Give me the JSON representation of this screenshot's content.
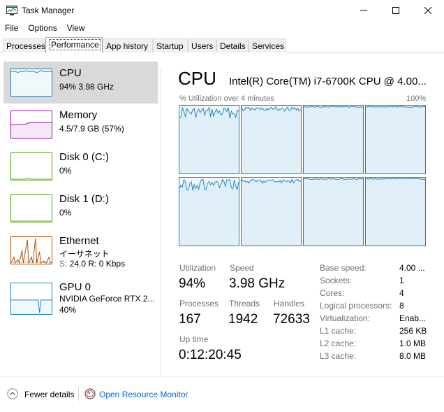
{
  "window": {
    "title": "Task Manager",
    "icon": "task-manager-icon"
  },
  "menu": [
    "File",
    "Options",
    "View"
  ],
  "tabs": [
    "Processes",
    "Performance",
    "App history",
    "Startup",
    "Users",
    "Details",
    "Services"
  ],
  "active_tab": "Performance",
  "sidebar": {
    "cpu": {
      "title": "CPU",
      "sub": "94%  3.98 GHz"
    },
    "memory": {
      "title": "Memory",
      "sub": "4.5/7.9 GB (57%)"
    },
    "disk0": {
      "title": "Disk 0 (C:)",
      "sub": "0%"
    },
    "disk1": {
      "title": "Disk 1 (D:)",
      "sub": "0%"
    },
    "ethernet": {
      "title": "Ethernet",
      "sub1": "イーサネット",
      "sub2_label": "S:",
      "sub2": "24.0  R: 0 Kbps"
    },
    "gpu": {
      "title": "GPU 0",
      "sub1": "NVIDIA GeForce RTX 2...",
      "sub2": "40%"
    }
  },
  "main": {
    "title": "CPU",
    "model": "Intel(R) Core(TM) i7-6700K CPU @ 4.00...",
    "graph_label_left": "% Utilization over 4 minutes",
    "graph_label_right": "100%",
    "stats": {
      "utilization_label": "Utilization",
      "utilization": "94%",
      "speed_label": "Speed",
      "speed": "3.98 GHz",
      "processes_label": "Processes",
      "processes": "167",
      "threads_label": "Threads",
      "threads": "1942",
      "handles_label": "Handles",
      "handles": "72633",
      "uptime_label": "Up time",
      "uptime": "0:12:20:45"
    },
    "specs": [
      {
        "label": "Base speed:",
        "value": "4.00 ..."
      },
      {
        "label": "Sockets:",
        "value": "1"
      },
      {
        "label": "Cores:",
        "value": "4"
      },
      {
        "label": "Logical processors:",
        "value": "8"
      },
      {
        "label": "Virtualization:",
        "value": "Enab..."
      },
      {
        "label": "L1 cache:",
        "value": "256 KB"
      },
      {
        "label": "L2 cache:",
        "value": "1.0 MB"
      },
      {
        "label": "L3 cache:",
        "value": "8.0 MB"
      }
    ]
  },
  "footer": {
    "fewer_details": "Fewer details",
    "open_monitor": "Open Resource Monitor"
  },
  "colors": {
    "cpu": "#1f7fbf",
    "memory": "#8b13a0",
    "disk": "#4da60c",
    "ethernet": "#a74f01",
    "gpu": "#1f7fbf",
    "link": "#0066cc"
  }
}
